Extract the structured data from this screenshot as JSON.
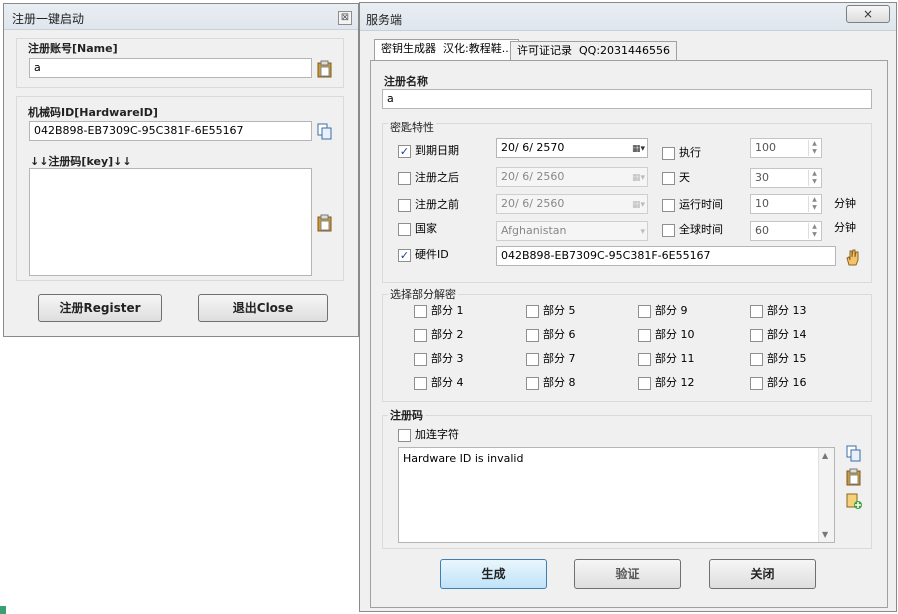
{
  "left_window": {
    "title": "注册一键启动",
    "close_glyph": "⊠",
    "name_label": "注册账号[Name]",
    "name_value": "a",
    "hwid_label": "机械码ID[HardwareID]",
    "hwid_value": "042B898-EB7309C-95C381F-6E55167",
    "key_label": "↓↓注册码[key]↓↓",
    "key_value": "",
    "register_button": "注册Register",
    "close_button": "退出Close"
  },
  "right_window": {
    "title": "服务端",
    "close_glyph": "×",
    "tabs": [
      {
        "label": "密钥生成器"
      },
      {
        "label": "汉化:教程鞋..."
      },
      {
        "label": "许可证记录"
      },
      {
        "label": "QQ:2031446556"
      }
    ],
    "reg_name_label": "注册名称",
    "reg_name_value": "a",
    "features_label": "密匙特性",
    "features": {
      "expire": {
        "label": "到期日期",
        "checked": true,
        "date": "20/ 6/ 2570"
      },
      "after": {
        "label": "注册之后",
        "checked": false,
        "date": "20/ 6/ 2560"
      },
      "before": {
        "label": "注册之前",
        "checked": false,
        "date": "20/ 6/ 2560"
      },
      "country": {
        "label": "国家",
        "checked": false,
        "value": "Afghanistan"
      },
      "hwid": {
        "label": "硬件ID",
        "checked": true,
        "value": "042B898-EB7309C-95C381F-6E55167"
      },
      "exec": {
        "label": "执行",
        "checked": false,
        "value": "100"
      },
      "days": {
        "label": "天",
        "checked": false,
        "value": "30"
      },
      "runtime": {
        "label": "运行时间",
        "checked": false,
        "value": "10",
        "unit": "分钟"
      },
      "globaltime": {
        "label": "全球时间",
        "checked": false,
        "value": "60",
        "unit": "分钟"
      }
    },
    "parts_label": "选择部分解密",
    "parts": [
      "部分 1",
      "部分 2",
      "部分 3",
      "部分 4",
      "部分 5",
      "部分 6",
      "部分 7",
      "部分 8",
      "部分 9",
      "部分 10",
      "部分 11",
      "部分 12",
      "部分 13",
      "部分 14",
      "部分 15",
      "部分 16"
    ],
    "regcode_label": "注册码",
    "add_chars_label": "加连字符",
    "regcode_value": "Hardware ID is invalid",
    "generate_button": "生成",
    "verify_button": "验证",
    "close_button": "关闭"
  },
  "colors": {
    "accent": "#3c7fb1",
    "check": "#1c3f94"
  }
}
